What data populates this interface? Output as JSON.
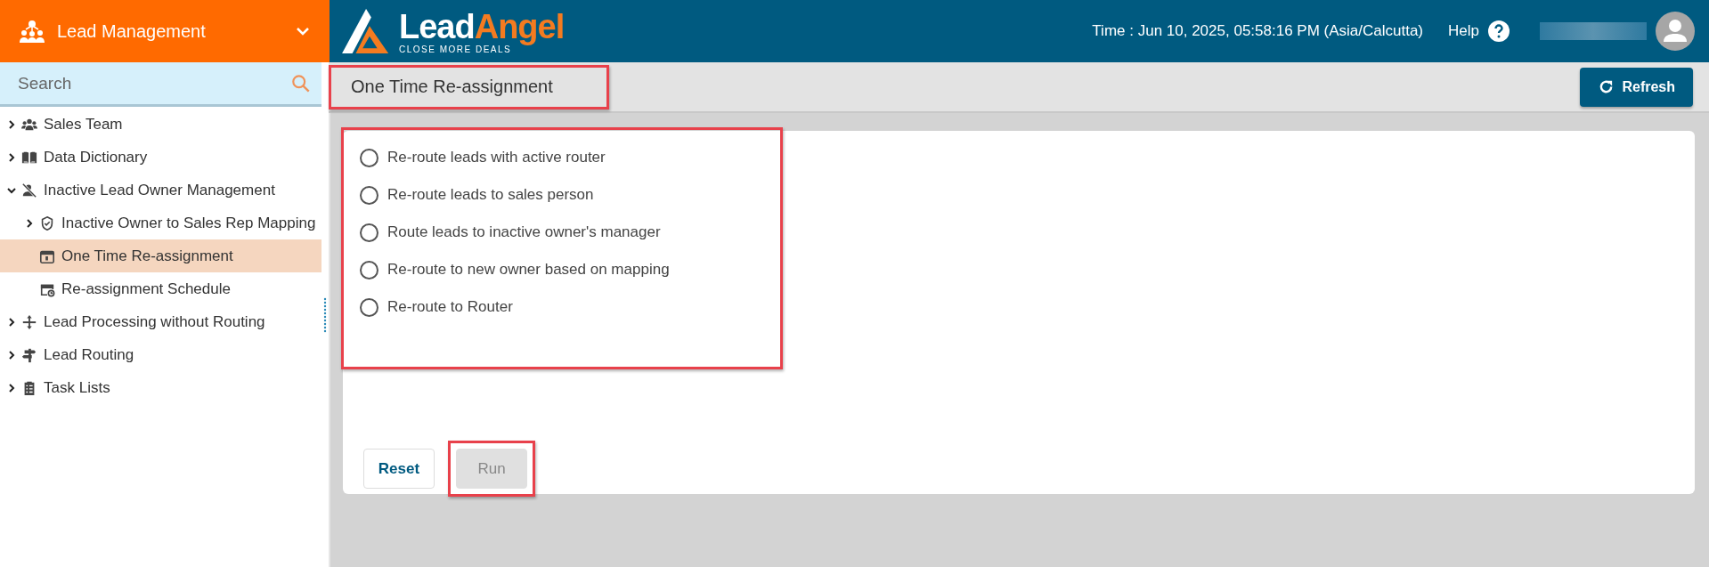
{
  "module_menu": {
    "title": "Lead Management"
  },
  "logo": {
    "word_1": "Lead",
    "word_2": "Angel",
    "tagline": "CLOSE MORE DEALS"
  },
  "header": {
    "time": "Time : Jun 10, 2025, 05:58:16 PM (Asia/Calcutta)",
    "help": "Help"
  },
  "search": {
    "placeholder": "Search"
  },
  "tree": [
    {
      "label": "Sales Team",
      "expanded": false,
      "selected": false
    },
    {
      "label": "Data Dictionary",
      "expanded": false,
      "selected": false
    },
    {
      "label": "Inactive Lead Owner Management",
      "expanded": true,
      "selected": false,
      "children": [
        {
          "label": "Inactive Owner to Sales Rep Mapping",
          "expanded": false,
          "selected": false
        },
        {
          "label": "One Time Re-assignment",
          "selected": true
        },
        {
          "label": "Re-assignment Schedule",
          "selected": false
        }
      ]
    },
    {
      "label": "Lead Processing without Routing",
      "expanded": false,
      "selected": false
    },
    {
      "label": "Lead Routing",
      "expanded": false,
      "selected": false
    },
    {
      "label": "Task Lists",
      "expanded": false,
      "selected": false
    }
  ],
  "page": {
    "title": "One Time Re-assignment",
    "highlighted": true,
    "refresh": "Refresh"
  },
  "options": {
    "highlighted": true,
    "items": [
      {
        "label": "Re-route leads with active router",
        "selected": false
      },
      {
        "label": "Re-route leads to sales person",
        "selected": false
      },
      {
        "label": "Route leads to inactive owner's manager",
        "selected": false
      },
      {
        "label": "Re-route to new owner based on mapping",
        "selected": false
      },
      {
        "label": "Re-route to Router",
        "selected": false
      }
    ]
  },
  "buttons": [
    {
      "label": "Reset",
      "disabled": false
    },
    {
      "label": "Run",
      "disabled": true,
      "highlighted": true
    }
  ]
}
